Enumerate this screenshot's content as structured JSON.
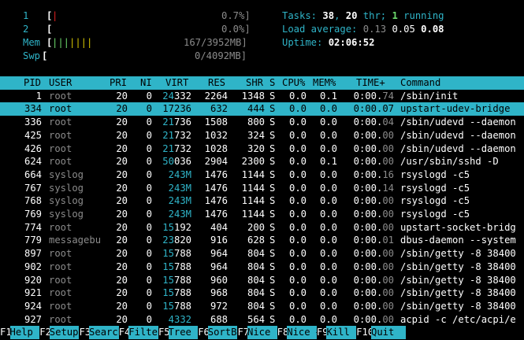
{
  "meters": {
    "cpu1": {
      "label": "1",
      "bar": "|",
      "value": "0.7%]"
    },
    "cpu2": {
      "label": "2",
      "bar": "",
      "value": "0.0%]"
    },
    "mem": {
      "label": "Mem",
      "bar_green": "|||",
      "bar_yellow": "||||",
      "value": "167/3952MB]"
    },
    "swp": {
      "label": "Swp",
      "bar": "",
      "value": "0/4092MB]"
    },
    "open_bracket": "["
  },
  "summary": {
    "tasks_label": "Tasks: ",
    "tasks": "38",
    "sep": ", ",
    "threads": "20",
    "thr_label": " thr; ",
    "running": "1",
    "running_label": " running",
    "load_label": "Load average: ",
    "load1": "0.13",
    "load5": "0.05",
    "load15": "0.08",
    "uptime_label": "Uptime: ",
    "uptime": "02:06:52"
  },
  "columns": [
    "PID",
    "USER",
    "PRI",
    "NI",
    "VIRT",
    "RES",
    "SHR",
    "S",
    "CPU%",
    "MEM%",
    "TIME+",
    "Command"
  ],
  "processes": [
    {
      "pid": "1",
      "user": "root",
      "pri": "20",
      "ni": "0",
      "virt_hi": "24",
      "virt_lo": "332",
      "res": "2264",
      "shr": "1348",
      "s": "S",
      "cpu": "0.0",
      "mem": "0.1",
      "time_a": "0:00.",
      "time_b": "74",
      "cmd": "/sbin/init"
    },
    {
      "pid": "334",
      "user": "root",
      "pri": "20",
      "ni": "0",
      "virt_hi": "17",
      "virt_lo": "236",
      "res": "632",
      "shr": "444",
      "s": "S",
      "cpu": "0.0",
      "mem": "0.0",
      "time_a": "0:00.",
      "time_b": "07",
      "cmd": "upstart-udev-bridge"
    },
    {
      "pid": "336",
      "user": "root",
      "pri": "20",
      "ni": "0",
      "virt_hi": "21",
      "virt_lo": "736",
      "res": "1508",
      "shr": "800",
      "s": "S",
      "cpu": "0.0",
      "mem": "0.0",
      "time_a": "0:00.",
      "time_b": "04",
      "cmd": "/sbin/udevd --daemon"
    },
    {
      "pid": "425",
      "user": "root",
      "pri": "20",
      "ni": "0",
      "virt_hi": "21",
      "virt_lo": "732",
      "res": "1032",
      "shr": "324",
      "s": "S",
      "cpu": "0.0",
      "mem": "0.0",
      "time_a": "0:00.",
      "time_b": "00",
      "cmd": "/sbin/udevd --daemon"
    },
    {
      "pid": "426",
      "user": "root",
      "pri": "20",
      "ni": "0",
      "virt_hi": "21",
      "virt_lo": "732",
      "res": "1028",
      "shr": "320",
      "s": "S",
      "cpu": "0.0",
      "mem": "0.0",
      "time_a": "0:00.",
      "time_b": "00",
      "cmd": "/sbin/udevd --daemon"
    },
    {
      "pid": "624",
      "user": "root",
      "pri": "20",
      "ni": "0",
      "virt_hi": "50",
      "virt_lo": "036",
      "res": "2904",
      "shr": "2300",
      "s": "S",
      "cpu": "0.0",
      "mem": "0.1",
      "time_a": "0:00.",
      "time_b": "00",
      "cmd": "/usr/sbin/sshd -D"
    },
    {
      "pid": "664",
      "user": "syslog",
      "pri": "20",
      "ni": "0",
      "virt_hi": "",
      "virt_lo": "243M",
      "res": "1476",
      "shr": "1144",
      "s": "S",
      "cpu": "0.0",
      "mem": "0.0",
      "time_a": "0:00.",
      "time_b": "16",
      "cmd": "rsyslogd -c5"
    },
    {
      "pid": "767",
      "user": "syslog",
      "pri": "20",
      "ni": "0",
      "virt_hi": "",
      "virt_lo": "243M",
      "res": "1476",
      "shr": "1144",
      "s": "S",
      "cpu": "0.0",
      "mem": "0.0",
      "time_a": "0:00.",
      "time_b": "14",
      "cmd": "rsyslogd -c5"
    },
    {
      "pid": "768",
      "user": "syslog",
      "pri": "20",
      "ni": "0",
      "virt_hi": "",
      "virt_lo": "243M",
      "res": "1476",
      "shr": "1144",
      "s": "S",
      "cpu": "0.0",
      "mem": "0.0",
      "time_a": "0:00.",
      "time_b": "00",
      "cmd": "rsyslogd -c5"
    },
    {
      "pid": "769",
      "user": "syslog",
      "pri": "20",
      "ni": "0",
      "virt_hi": "",
      "virt_lo": "243M",
      "res": "1476",
      "shr": "1144",
      "s": "S",
      "cpu": "0.0",
      "mem": "0.0",
      "time_a": "0:00.",
      "time_b": "00",
      "cmd": "rsyslogd -c5"
    },
    {
      "pid": "774",
      "user": "root",
      "pri": "20",
      "ni": "0",
      "virt_hi": "15",
      "virt_lo": "192",
      "res": "404",
      "shr": "200",
      "s": "S",
      "cpu": "0.0",
      "mem": "0.0",
      "time_a": "0:00.",
      "time_b": "00",
      "cmd": "upstart-socket-bridg"
    },
    {
      "pid": "779",
      "user": "messagebu",
      "pri": "20",
      "ni": "0",
      "virt_hi": "23",
      "virt_lo": "820",
      "res": "916",
      "shr": "628",
      "s": "S",
      "cpu": "0.0",
      "mem": "0.0",
      "time_a": "0:00.",
      "time_b": "01",
      "cmd": "dbus-daemon --system"
    },
    {
      "pid": "897",
      "user": "root",
      "pri": "20",
      "ni": "0",
      "virt_hi": "15",
      "virt_lo": "788",
      "res": "964",
      "shr": "804",
      "s": "S",
      "cpu": "0.0",
      "mem": "0.0",
      "time_a": "0:00.",
      "time_b": "00",
      "cmd": "/sbin/getty -8 38400"
    },
    {
      "pid": "902",
      "user": "root",
      "pri": "20",
      "ni": "0",
      "virt_hi": "15",
      "virt_lo": "788",
      "res": "964",
      "shr": "804",
      "s": "S",
      "cpu": "0.0",
      "mem": "0.0",
      "time_a": "0:00.",
      "time_b": "00",
      "cmd": "/sbin/getty -8 38400"
    },
    {
      "pid": "920",
      "user": "root",
      "pri": "20",
      "ni": "0",
      "virt_hi": "15",
      "virt_lo": "788",
      "res": "960",
      "shr": "804",
      "s": "S",
      "cpu": "0.0",
      "mem": "0.0",
      "time_a": "0:00.",
      "time_b": "00",
      "cmd": "/sbin/getty -8 38400"
    },
    {
      "pid": "921",
      "user": "root",
      "pri": "20",
      "ni": "0",
      "virt_hi": "15",
      "virt_lo": "788",
      "res": "968",
      "shr": "804",
      "s": "S",
      "cpu": "0.0",
      "mem": "0.0",
      "time_a": "0:00.",
      "time_b": "00",
      "cmd": "/sbin/getty -8 38400"
    },
    {
      "pid": "924",
      "user": "root",
      "pri": "20",
      "ni": "0",
      "virt_hi": "15",
      "virt_lo": "788",
      "res": "972",
      "shr": "804",
      "s": "S",
      "cpu": "0.0",
      "mem": "0.0",
      "time_a": "0:00.",
      "time_b": "00",
      "cmd": "/sbin/getty -8 38400"
    },
    {
      "pid": "927",
      "user": "root",
      "pri": "20",
      "ni": "0",
      "virt_hi": "",
      "virt_lo": "4332",
      "res": "688",
      "shr": "564",
      "s": "S",
      "cpu": "0.0",
      "mem": "0.0",
      "time_a": "0:00.",
      "time_b": "00",
      "cmd": "acpid -c /etc/acpi/e"
    }
  ],
  "fkeys": [
    {
      "key": "F1",
      "label": "Help  "
    },
    {
      "key": "F2",
      "label": "Setup "
    },
    {
      "key": "F3",
      "label": "Search"
    },
    {
      "key": "F4",
      "label": "Filter"
    },
    {
      "key": "F5",
      "label": "Tree  "
    },
    {
      "key": "F6",
      "label": "SortBy"
    },
    {
      "key": "F7",
      "label": "Nice -"
    },
    {
      "key": "F8",
      "label": "Nice +"
    },
    {
      "key": "F9",
      "label": "Kill  "
    },
    {
      "key": "F10",
      "label": "Quit  "
    }
  ],
  "colors": {
    "accent": "#2fb4c8",
    "green": "#6cd86c",
    "yellow": "#d4c400",
    "red": "#e02020",
    "bg": "#000000"
  },
  "selected_row": 1
}
